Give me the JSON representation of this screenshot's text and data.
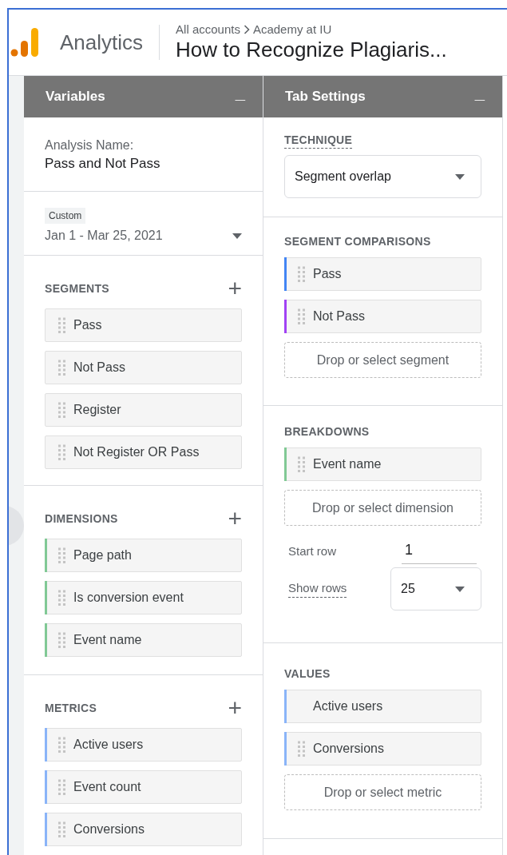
{
  "header": {
    "product": "Analytics",
    "breadcrumb": [
      "All accounts",
      "Academy at IU"
    ],
    "title": "How to Recognize Plagiaris..."
  },
  "variables": {
    "title": "Variables",
    "collapse": "_",
    "analysis_label": "Analysis Name:",
    "analysis_name": "Pass and Not Pass",
    "date_badge": "Custom",
    "date_range": "Jan 1 - Mar 25, 2021",
    "sections": [
      {
        "title": "SEGMENTS",
        "add": "+",
        "items": [
          {
            "label": "Pass"
          },
          {
            "label": "Not Pass"
          },
          {
            "label": "Register"
          },
          {
            "label": "Not Register OR Pass"
          }
        ]
      },
      {
        "title": "DIMENSIONS",
        "add": "+",
        "items": [
          {
            "label": "Page path",
            "color": "#81c995"
          },
          {
            "label": "Is conversion event",
            "color": "#81c995"
          },
          {
            "label": "Event name",
            "color": "#81c995"
          }
        ]
      },
      {
        "title": "METRICS",
        "add": "+",
        "items": [
          {
            "label": "Active users",
            "color": "#8ab4f8"
          },
          {
            "label": "Event count",
            "color": "#8ab4f8"
          },
          {
            "label": "Conversions",
            "color": "#8ab4f8"
          }
        ]
      }
    ]
  },
  "tab_settings": {
    "title": "Tab Settings",
    "collapse": "_",
    "technique_label": "TECHNIQUE",
    "technique": "Segment overlap",
    "segment_comparisons": {
      "title": "SEGMENT COMPARISONS",
      "items": [
        {
          "label": "Pass",
          "color": "#4285f4"
        },
        {
          "label": "Not Pass",
          "color": "#a142f4"
        }
      ],
      "drop": "Drop or select segment"
    },
    "breakdowns": {
      "title": "BREAKDOWNS",
      "items": [
        {
          "label": "Event name",
          "color": "#81c995"
        }
      ],
      "drop": "Drop or select dimension",
      "start_row_label": "Start row",
      "start_row": "1",
      "show_rows_label": "Show rows",
      "show_rows": "25"
    },
    "values": {
      "title": "VALUES",
      "items": [
        {
          "label": "Active users",
          "color": "#8ab4f8",
          "handle": false
        },
        {
          "label": "Conversions",
          "color": "#8ab4f8",
          "handle": true
        }
      ],
      "drop": "Drop or select metric"
    }
  }
}
